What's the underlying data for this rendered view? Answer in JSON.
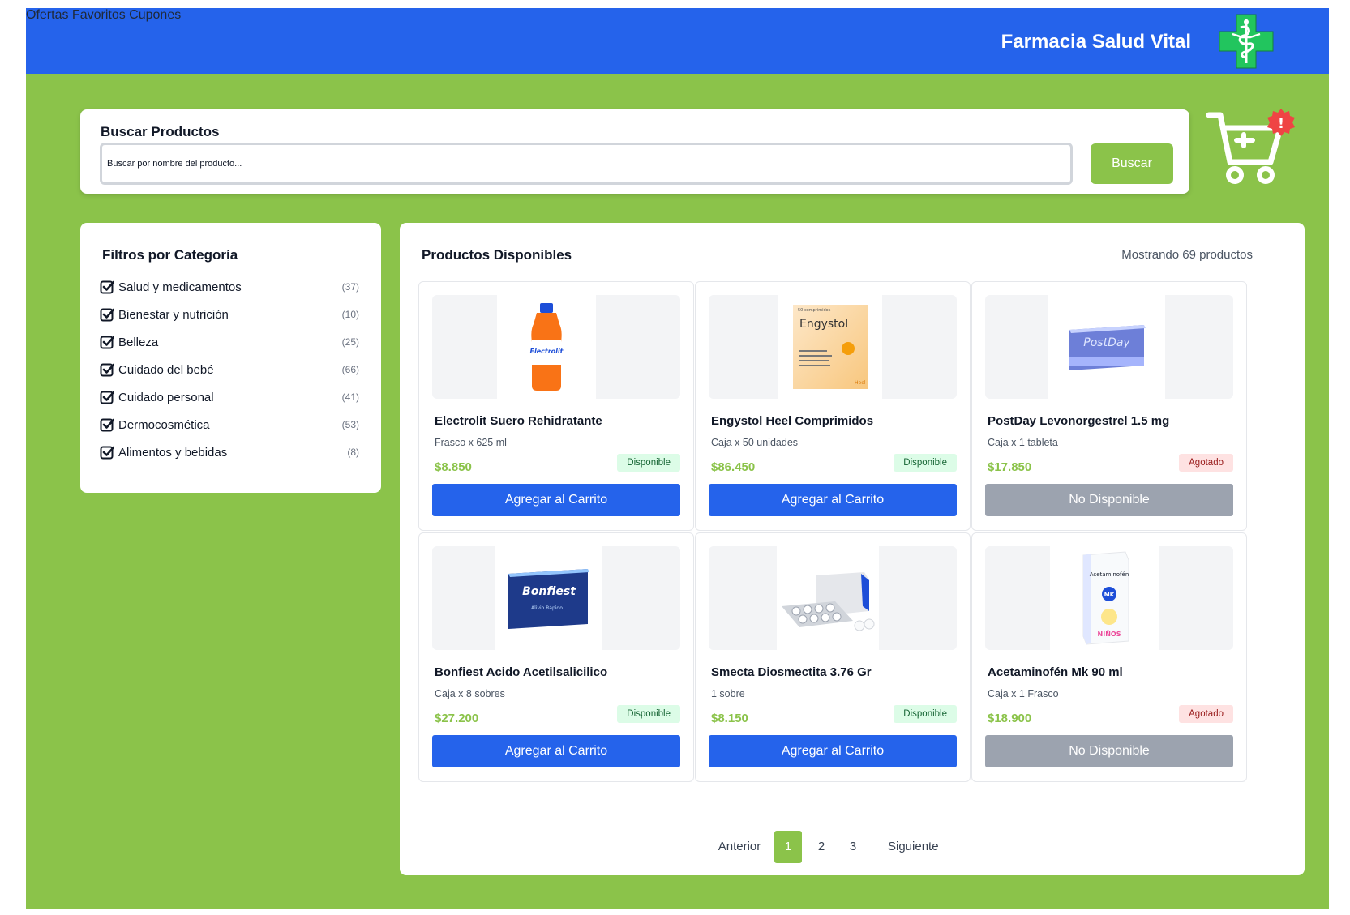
{
  "header": {
    "nav": [
      "Ofertas",
      "Favoritos",
      "Cupones"
    ],
    "brand": "Farmacia Salud Vital",
    "logo_icon": "pharmacy-cross-caduceus-icon",
    "colors": {
      "primary": "#2563eb",
      "accent": "#8bc34a",
      "logo": "#22c55e"
    }
  },
  "search": {
    "label": "Buscar Productos",
    "placeholder": "Buscar por nombre del producto...",
    "value": "",
    "button": "Buscar"
  },
  "cart": {
    "icon": "shopping-cart-plus-icon",
    "badge": "!"
  },
  "filters": {
    "title": "Filtros por Categoría",
    "items": [
      {
        "label": "Salud y medicamentos",
        "count": "(37)",
        "checked": true
      },
      {
        "label": "Bienestar y nutrición",
        "count": "(10)",
        "checked": true
      },
      {
        "label": "Belleza",
        "count": "(25)",
        "checked": true
      },
      {
        "label": "Cuidado del bebé",
        "count": "(66)",
        "checked": true
      },
      {
        "label": "Cuidado personal",
        "count": "(41)",
        "checked": true
      },
      {
        "label": "Dermocosmética",
        "count": "(53)",
        "checked": true
      },
      {
        "label": "Alimentos y bebidas",
        "count": "(8)",
        "checked": true
      }
    ]
  },
  "products": {
    "title": "Productos Disponibles",
    "count_text": "Mostrando 69 productos",
    "items": [
      {
        "name": "Electrolit Suero Rehidratante",
        "presentation": "Frasco x 625 ml",
        "price": "$8.850",
        "status": "Disponible",
        "available": true,
        "button": "Agregar al Carrito",
        "image_icon": "electrolit-bottle-icon",
        "image_text": "Electrolit"
      },
      {
        "name": "Engystol Heel Comprimidos",
        "presentation": "Caja x 50 unidades",
        "price": "$86.450",
        "status": "Disponible",
        "available": true,
        "button": "Agregar al Carrito",
        "image_icon": "engystol-box-icon",
        "image_text": "Engystol"
      },
      {
        "name": "PostDay Levonorgestrel 1.5 mg",
        "presentation": "Caja x 1 tableta",
        "price": "$17.850",
        "status": "Agotado",
        "available": false,
        "button": "No Disponible",
        "image_icon": "postday-box-icon",
        "image_text": "PostDay"
      },
      {
        "name": "Bonfiest Acido Acetilsalicilico",
        "presentation": "Caja x 8 sobres",
        "price": "$27.200",
        "status": "Disponible",
        "available": true,
        "button": "Agregar al Carrito",
        "image_icon": "bonfiest-box-icon",
        "image_text": "Bonfiest"
      },
      {
        "name": "Smecta Diosmectita 3.76 Gr",
        "presentation": "1 sobre",
        "price": "$8.150",
        "status": "Disponible",
        "available": true,
        "button": "Agregar al Carrito",
        "image_icon": "tablets-blister-icon",
        "image_text": ""
      },
      {
        "name": "Acetaminofén Mk 90 ml",
        "presentation": "Caja x 1 Frasco",
        "price": "$18.900",
        "status": "Agotado",
        "available": false,
        "button": "No Disponible",
        "image_icon": "acetaminofen-box-icon",
        "image_text": "Acetaminofén"
      }
    ]
  },
  "pagination": {
    "prev": "Anterior",
    "pages": [
      "1",
      "2",
      "3"
    ],
    "current": "1",
    "next": "Siguiente"
  }
}
